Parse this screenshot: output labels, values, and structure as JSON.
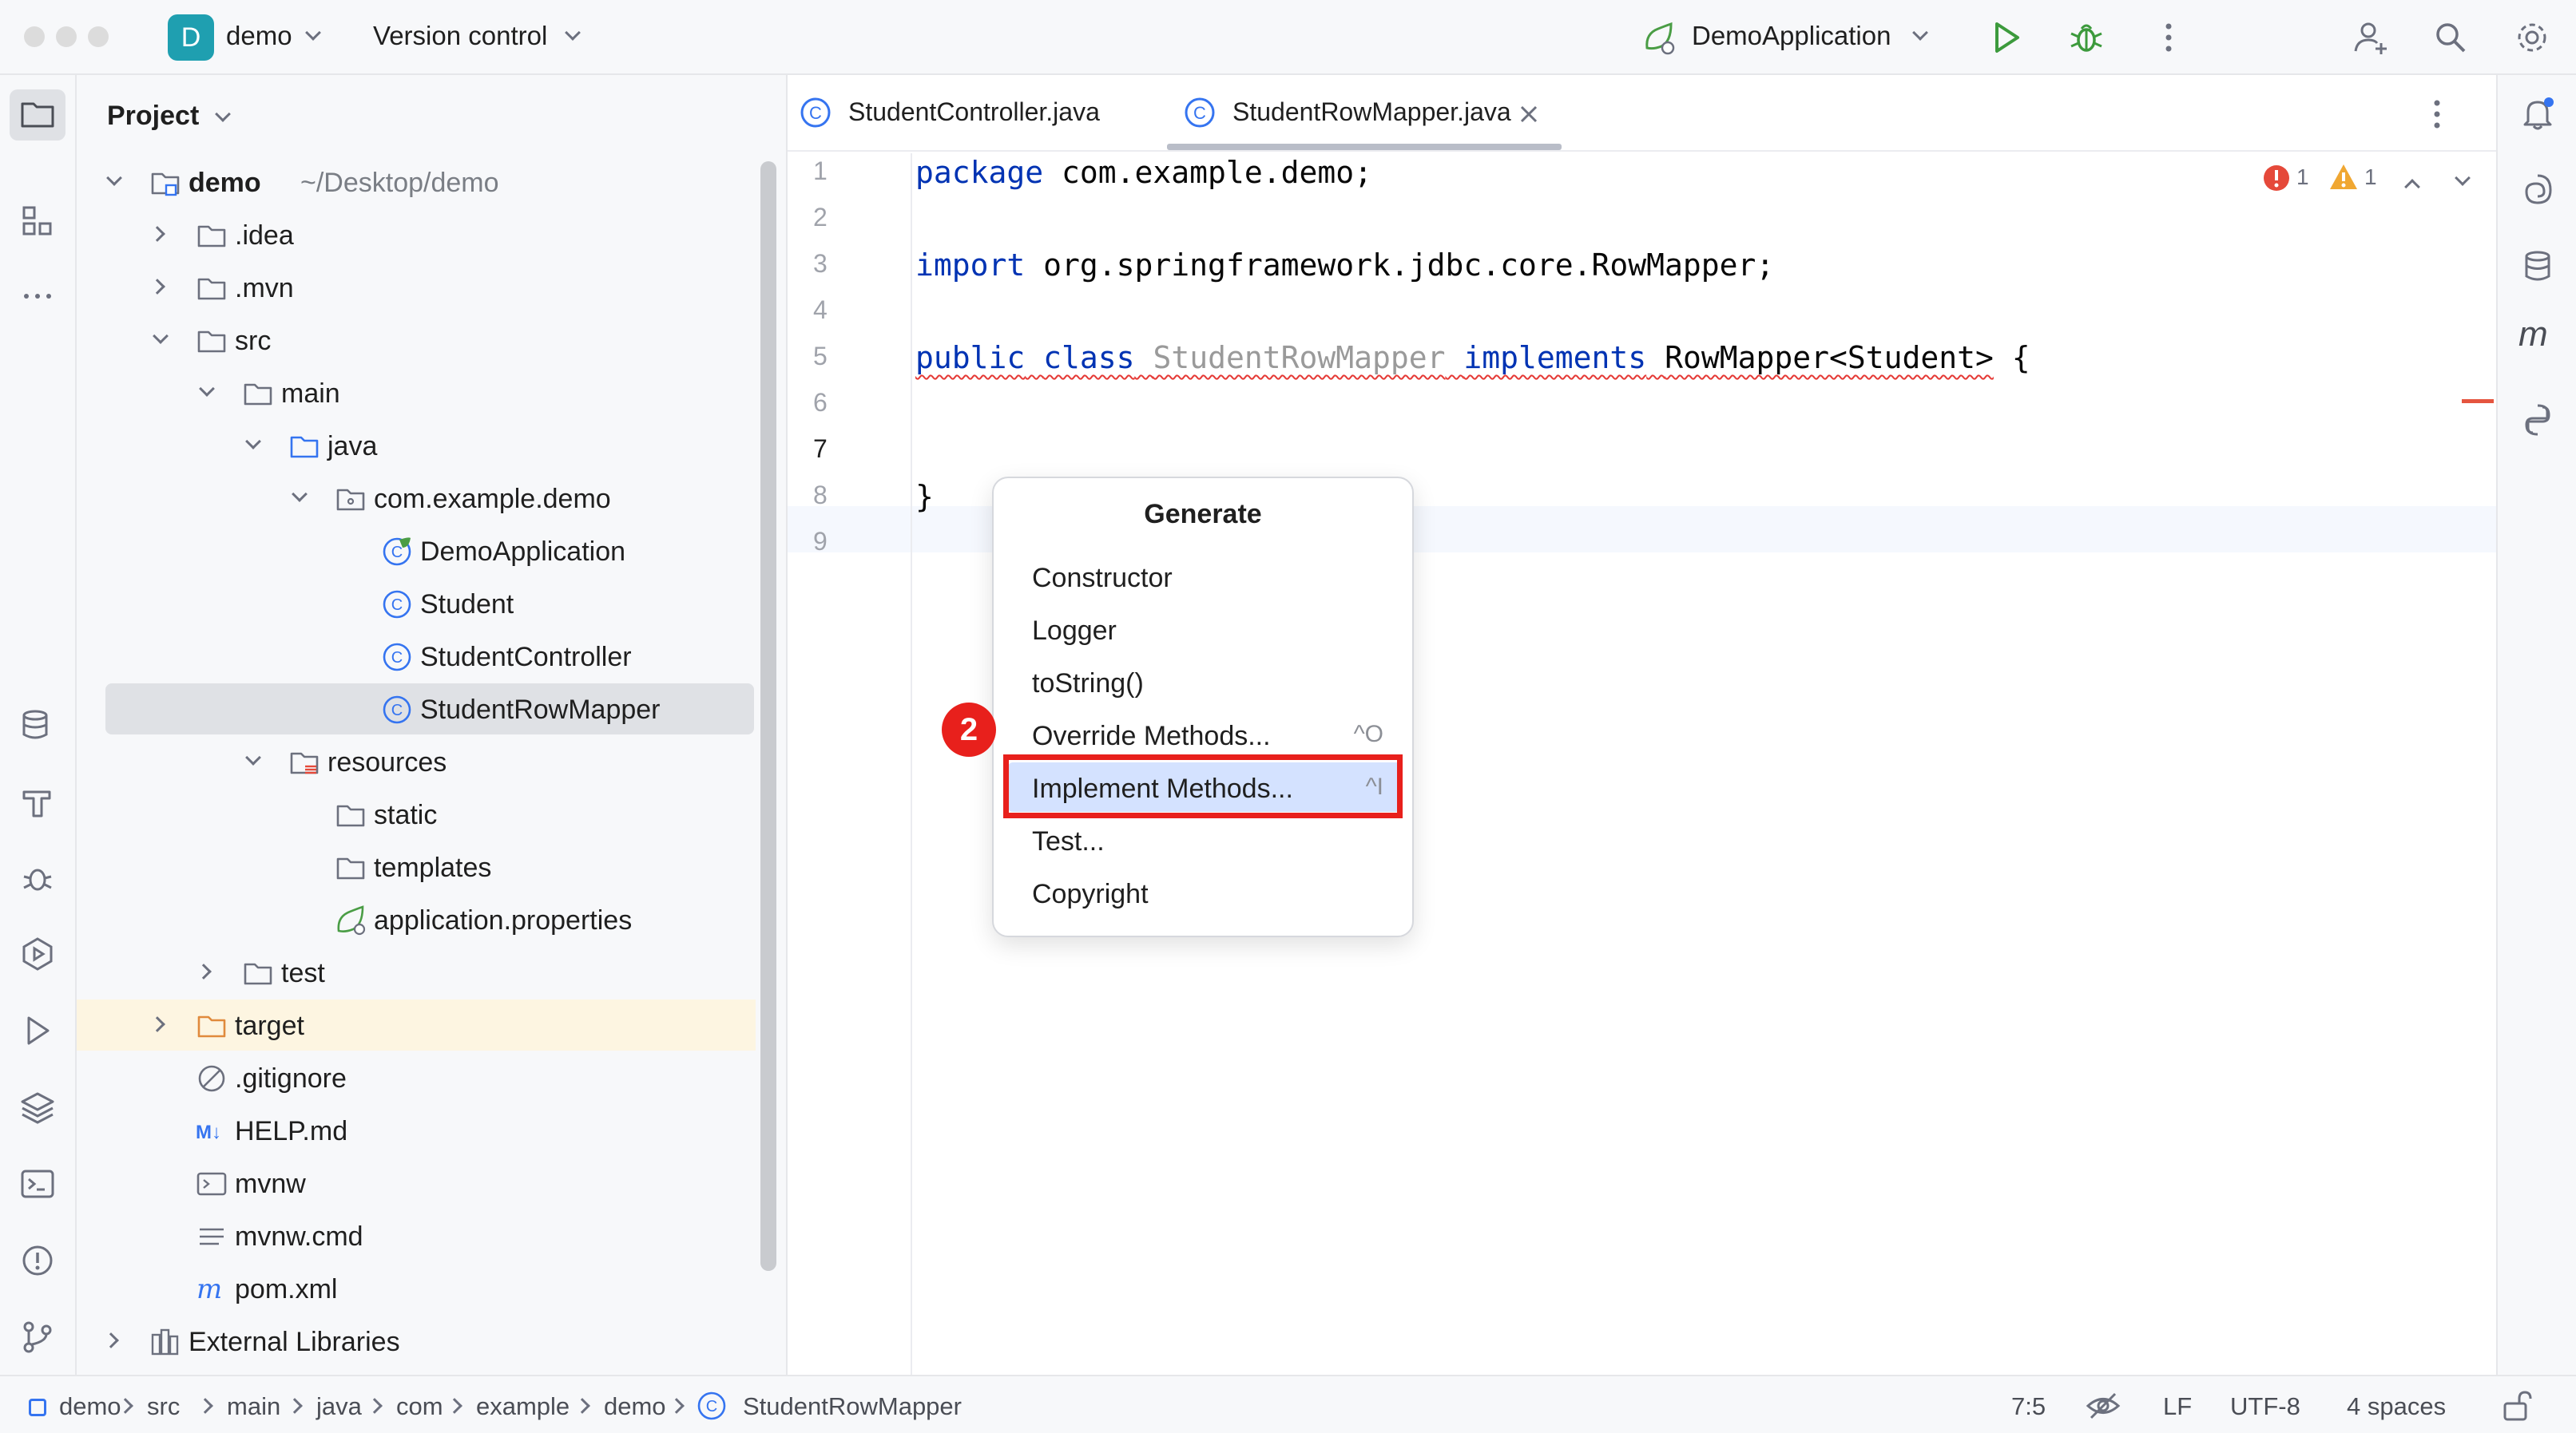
{
  "titlebar": {
    "project_badge": "D",
    "project_name": "demo",
    "vcs": "Version control",
    "run_config": "DemoApplication"
  },
  "project_panel": {
    "title": "Project",
    "tree": [
      {
        "label": "demo",
        "sub": "~/Desktop/demo",
        "depth": 0,
        "arrow": "down",
        "icon": "module-folder-icon"
      },
      {
        "label": ".idea",
        "depth": 1,
        "arrow": "right",
        "icon": "folder-icon"
      },
      {
        "label": ".mvn",
        "depth": 1,
        "arrow": "right",
        "icon": "folder-icon"
      },
      {
        "label": "src",
        "depth": 1,
        "arrow": "down",
        "icon": "folder-icon"
      },
      {
        "label": "main",
        "depth": 2,
        "arrow": "down",
        "icon": "folder-icon"
      },
      {
        "label": "java",
        "depth": 3,
        "arrow": "down",
        "icon": "source-folder-icon"
      },
      {
        "label": "com.example.demo",
        "depth": 4,
        "arrow": "down",
        "icon": "package-icon"
      },
      {
        "label": "DemoApplication",
        "depth": 5,
        "arrow": "",
        "icon": "spring-class-icon"
      },
      {
        "label": "Student",
        "depth": 5,
        "arrow": "",
        "icon": "class-icon"
      },
      {
        "label": "StudentController",
        "depth": 5,
        "arrow": "",
        "icon": "class-icon"
      },
      {
        "label": "StudentRowMapper",
        "depth": 5,
        "arrow": "",
        "icon": "class-icon"
      },
      {
        "label": "resources",
        "depth": 3,
        "arrow": "down",
        "icon": "resources-folder-icon"
      },
      {
        "label": "static",
        "depth": 4,
        "arrow": "",
        "icon": "folder-icon"
      },
      {
        "label": "templates",
        "depth": 4,
        "arrow": "",
        "icon": "folder-icon"
      },
      {
        "label": "application.properties",
        "depth": 4,
        "arrow": "",
        "icon": "spring-properties-icon"
      },
      {
        "label": "test",
        "depth": 2,
        "arrow": "right",
        "icon": "folder-icon"
      },
      {
        "label": "target",
        "depth": 1,
        "arrow": "right",
        "icon": "excluded-folder-icon"
      },
      {
        "label": ".gitignore",
        "depth": 1,
        "arrow": "",
        "icon": "ignore-file-icon"
      },
      {
        "label": "HELP.md",
        "depth": 1,
        "arrow": "",
        "icon": "markdown-icon"
      },
      {
        "label": "mvnw",
        "depth": 1,
        "arrow": "",
        "icon": "terminal-file-icon"
      },
      {
        "label": "mvnw.cmd",
        "depth": 1,
        "arrow": "",
        "icon": "text-file-icon"
      },
      {
        "label": "pom.xml",
        "depth": 1,
        "arrow": "",
        "icon": "maven-icon"
      },
      {
        "label": "External Libraries",
        "depth": 0,
        "arrow": "right",
        "icon": "library-icon"
      }
    ]
  },
  "editor": {
    "tabs": [
      {
        "label": "StudentController.java",
        "active": false
      },
      {
        "label": "StudentRowMapper.java",
        "active": true
      }
    ],
    "line_numbers": [
      "1",
      "2",
      "3",
      "4",
      "5",
      "6",
      "7",
      "8",
      "9"
    ],
    "code": {
      "line1_kw": "package",
      "line1_rest": " com.example.demo;",
      "line3_kw": "import",
      "line3_rest": " org.springframework.jdbc.core.RowMapper;",
      "line5_public": "public",
      "line5_class": "class",
      "line5_name": "StudentRowMapper",
      "line5_implements": "implements",
      "line5_type": "RowMapper<Student>",
      "line5_brace": " {",
      "line8": "}"
    },
    "inspections": {
      "errors": "1",
      "warnings": "1"
    }
  },
  "popup": {
    "title": "Generate",
    "items": [
      {
        "label": "Constructor",
        "shortcut": ""
      },
      {
        "label": "Logger",
        "shortcut": ""
      },
      {
        "label": "toString()",
        "shortcut": ""
      },
      {
        "label": "Override Methods...",
        "shortcut": "^O"
      },
      {
        "label": "Implement Methods...",
        "shortcut": "^I"
      },
      {
        "label": "Test...",
        "shortcut": ""
      },
      {
        "label": "Copyright",
        "shortcut": ""
      }
    ],
    "step_badge": "2"
  },
  "statusbar": {
    "breadcrumb": [
      "demo",
      "src",
      "main",
      "java",
      "com",
      "example",
      "demo",
      "StudentRowMapper"
    ],
    "position": "7:5",
    "line_ending": "LF",
    "encoding": "UTF-8",
    "indent": "4 spaces"
  },
  "colors": {
    "accent": "#3574f0",
    "highlight": "#e8201c",
    "selection": "#d4e2ff",
    "keyword": "#0033b3"
  }
}
